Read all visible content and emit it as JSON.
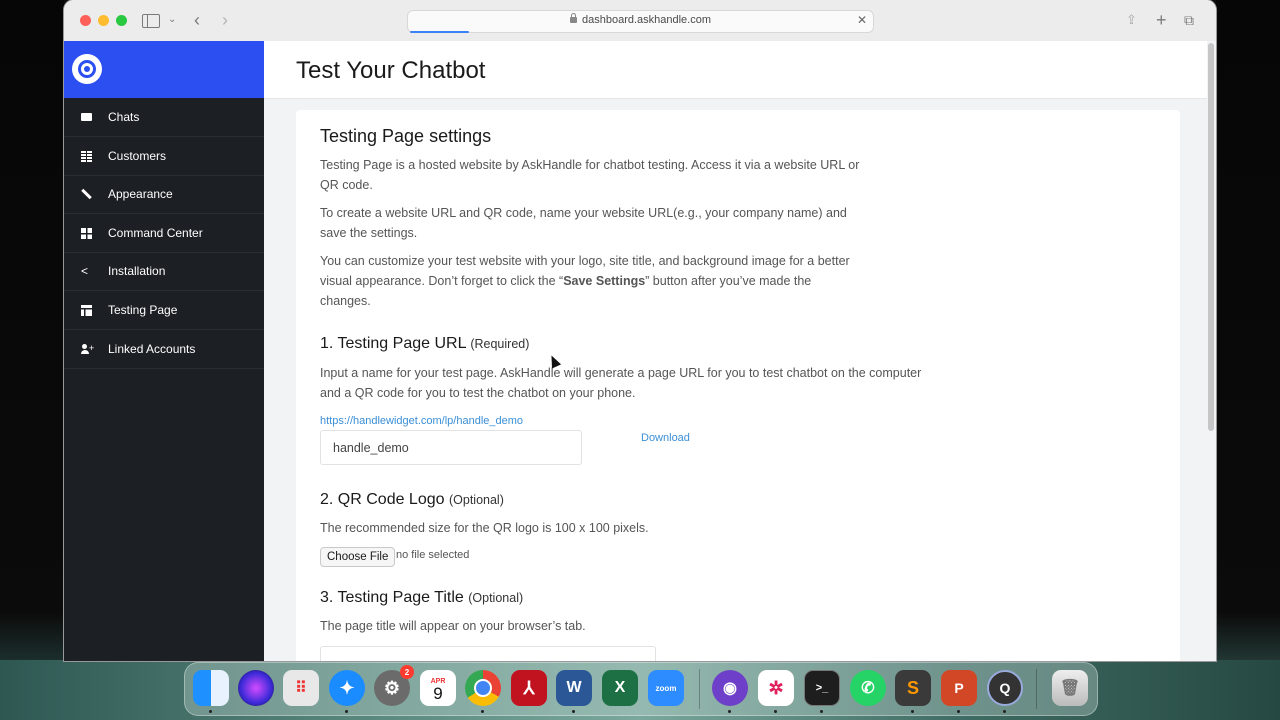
{
  "browser": {
    "url": "dashboard.askhandle.com"
  },
  "sidebar": {
    "items": [
      {
        "label": "Chats",
        "icon": "chat-icon"
      },
      {
        "label": "Customers",
        "icon": "table-icon"
      },
      {
        "label": "Appearance",
        "icon": "brush-icon"
      },
      {
        "label": "Command Center",
        "icon": "grid-icon"
      },
      {
        "label": "Installation",
        "icon": "share-icon"
      },
      {
        "label": "Testing Page",
        "icon": "page-icon"
      },
      {
        "label": "Linked Accounts",
        "icon": "add-user-icon"
      }
    ]
  },
  "page": {
    "title": "Test Your Chatbot"
  },
  "settings": {
    "heading": "Testing Page settings",
    "intro1": "Testing Page is a hosted website by AskHandle for chatbot testing. Access it via a website URL or QR code.",
    "intro2": "To create a website URL and QR code, name your website URL(e.g., your company name) and save the settings.",
    "intro3_a": "You can customize your test website with your logo, site title, and background image for a better visual appearance. Don’t forget to click the “",
    "intro3_b": "Save Settings",
    "intro3_c": "” button after you’ve made the changes."
  },
  "section1": {
    "title": "1. Testing Page URL",
    "tag": "(Required)",
    "desc": "Input a name for your test page. AskHandle will generate a page URL for you to test chatbot on the computer and a QR code for you to test the chatbot on your phone.",
    "link": "https://handlewidget.com/lp/handle_demo",
    "input_value": "handle_demo",
    "download_label": "Download"
  },
  "section2": {
    "title": "2. QR Code Logo",
    "tag": "(Optional)",
    "desc": "The recommended size for the QR logo is 100 x 100 pixels.",
    "choose_label": "Choose File",
    "no_file": "no file selected"
  },
  "section3": {
    "title": "3. Testing Page Title",
    "tag": "(Optional)",
    "desc": "The page title will appear on your browser’s tab."
  },
  "dock": {
    "calendar_month": "APR",
    "calendar_day": "9",
    "settings_badge": "2",
    "zoom_label": "zoom"
  },
  "colors": {
    "brand": "#2b4ff0",
    "nav_bg": "#1c1f24",
    "link": "#3b8fd6"
  }
}
